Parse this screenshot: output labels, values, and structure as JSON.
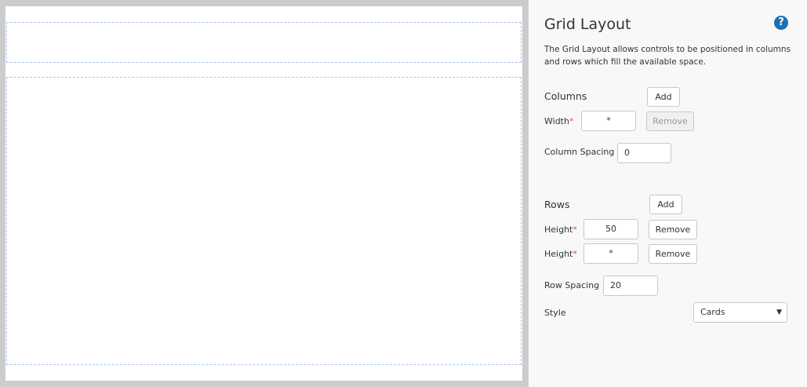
{
  "panel": {
    "title": "Grid Layout",
    "help_icon": "question-circle-icon",
    "description": "The Grid Layout allows controls to be positioned in columns and rows which fill the available space.",
    "columns": {
      "heading": "Columns",
      "add": "Add",
      "width_label": "Width",
      "required": "*",
      "width_value": "*",
      "remove": "Remove",
      "spacing_label": "Column Spacing",
      "spacing_value": "0"
    },
    "rows": {
      "heading": "Rows",
      "add": "Add",
      "height_label": "Height",
      "required": "*",
      "items": [
        {
          "value": "50",
          "remove": "Remove"
        },
        {
          "value": "*",
          "remove": "Remove"
        }
      ],
      "spacing_label": "Row Spacing",
      "spacing_value": "20"
    },
    "style": {
      "label": "Style",
      "value": "Cards"
    }
  },
  "colors": {
    "accent": "#1f6fb5",
    "guide": "#a9c4ef"
  }
}
